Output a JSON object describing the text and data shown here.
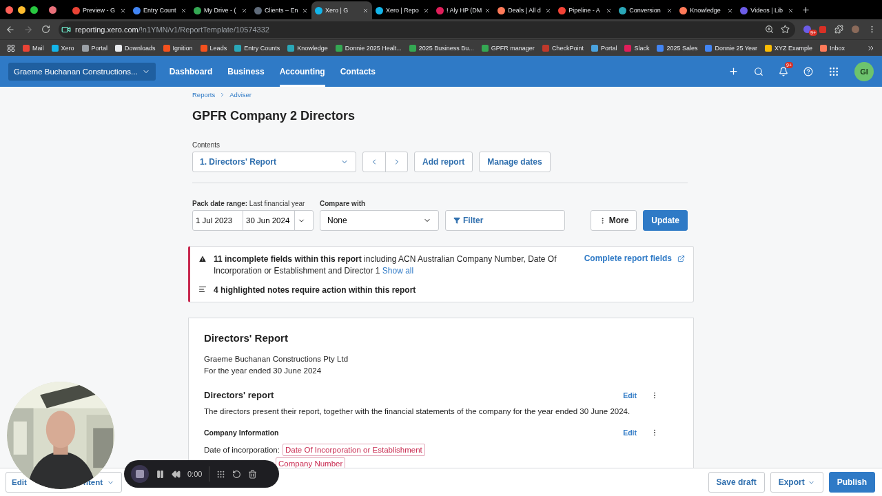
{
  "browser": {
    "tabs": [
      {
        "title": "Preview - G",
        "selected": false,
        "color": "#ea4335"
      },
      {
        "title": "Entry Count",
        "selected": false,
        "color": "#4285f4"
      },
      {
        "title": "My Drive - (",
        "selected": false,
        "color": "#34a853"
      },
      {
        "title": "Clients – En",
        "selected": false,
        "color": "#5f6b7a"
      },
      {
        "title": "Xero | G",
        "selected": true,
        "color": "#13b5ea"
      },
      {
        "title": "Xero | Repo",
        "selected": false,
        "color": "#13b5ea"
      },
      {
        "title": "! Aly HP (DM",
        "selected": false,
        "color": "#e01e5a"
      },
      {
        "title": "Deals | All d",
        "selected": false,
        "color": "#ff7a59"
      },
      {
        "title": "Pipeline - A",
        "selected": false,
        "color": "#f44336"
      },
      {
        "title": "Conversion",
        "selected": false,
        "color": "#2aa7b8"
      },
      {
        "title": "Knowledge",
        "selected": false,
        "color": "#ff7a59"
      },
      {
        "title": "Videos | Lib",
        "selected": false,
        "color": "#6c5ce7"
      }
    ],
    "url_host": "reporting.xero.com",
    "url_path": "/!n1YMN/v1/ReportTemplate/10574332",
    "extension_badge": "9+",
    "bookmarks": [
      {
        "label": "Mail",
        "color": "#ea4335"
      },
      {
        "label": "Xero",
        "color": "#13b5ea"
      },
      {
        "label": "Portal",
        "color": "#9aa0a6"
      },
      {
        "label": "Downloads",
        "color": "#e8eaed"
      },
      {
        "label": "Ignition",
        "color": "#f4511e"
      },
      {
        "label": "Leads",
        "color": "#f4511e"
      },
      {
        "label": "Entry Counts",
        "color": "#2aa7b8"
      },
      {
        "label": "Knowledge",
        "color": "#2aa7b8"
      },
      {
        "label": "Donnie 2025 Healt...",
        "color": "#34a853"
      },
      {
        "label": "2025 Business Bu...",
        "color": "#34a853"
      },
      {
        "label": "GPFR manager",
        "color": "#34a853"
      },
      {
        "label": "CheckPoint",
        "color": "#c0392b"
      },
      {
        "label": "Portal",
        "color": "#4aa3df"
      },
      {
        "label": "Slack",
        "color": "#e01e5a"
      },
      {
        "label": "2025 Sales",
        "color": "#4285f4"
      },
      {
        "label": "Donnie 25 Year",
        "color": "#4285f4"
      },
      {
        "label": "XYZ Example",
        "color": "#fbbc04"
      },
      {
        "label": "Inbox",
        "color": "#ff7a59"
      }
    ]
  },
  "nav": {
    "org": "Graeme Buchanan Constructions...",
    "items": [
      {
        "label": "Dashboard",
        "selected": false
      },
      {
        "label": "Business",
        "selected": false
      },
      {
        "label": "Accounting",
        "selected": true
      },
      {
        "label": "Contacts",
        "selected": false
      }
    ],
    "notification_badge": "9+",
    "avatar": "GI"
  },
  "breadcrumbs": [
    "Reports",
    "Adviser"
  ],
  "title": "GPFR Company 2 Directors",
  "contents": {
    "label": "Contents",
    "value": "1. Directors' Report",
    "buttons": [
      "Add report",
      "Manage dates"
    ]
  },
  "filters": {
    "pack_label": "Pack date range:",
    "pack_hint": "Last financial year",
    "from": "1 Jul 2023",
    "to": "30 Jun 2024",
    "compare_label": "Compare with",
    "compare_value": "None",
    "filter": "Filter",
    "more": "More",
    "update": "Update"
  },
  "alert": {
    "message": "**11 incomplete fields within this report** including ACN Australian Company Number, Date Of Incorporation or Establishment and Director 1",
    "show_all": "Show all",
    "action": "Complete report fields",
    "notes": "4 highlighted notes require action within this report"
  },
  "report": {
    "heading": "Directors' Report",
    "company": "Graeme Buchanan Constructions Pty Ltd",
    "period": "For the year ended 30 June 2024",
    "sections": [
      {
        "title": "Directors' report",
        "kind": "heading",
        "edit": "Edit",
        "body": "The directors present their report, together with the financial statements of the company for the year ended 30 June 2024."
      },
      {
        "title": "Company Information",
        "kind": "subheading",
        "edit": "Edit",
        "fields": [
          {
            "label": "Date of incorporation:",
            "tag": "Date Of Incorporation or Establishment"
          },
          {
            "tag": "Company Number"
          }
        ]
      }
    ]
  },
  "footer": {
    "left_start": "Edit",
    "left_end": "ntent",
    "save": "Save draft",
    "export": "Export",
    "publish": "Publish"
  },
  "recorder": {
    "time": "0:00"
  }
}
